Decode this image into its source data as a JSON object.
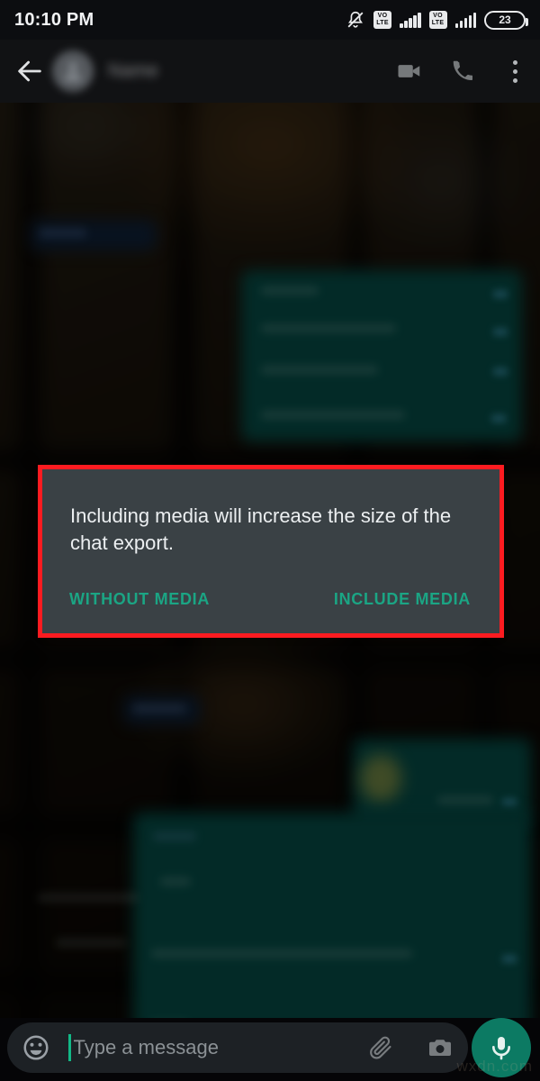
{
  "status_bar": {
    "clock": "10:10 PM",
    "icons": [
      {
        "name": "bell-muted-icon",
        "label": "silent"
      },
      {
        "name": "volte-badge-sim1",
        "label": "VoLTE"
      },
      {
        "name": "signal-bars-sim1",
        "label": "signal"
      },
      {
        "name": "volte-badge-sim2",
        "label": "VoLTE"
      },
      {
        "name": "signal-bars-sim2",
        "label": "signal"
      }
    ],
    "volte_top": "VO",
    "volte_bottom": "LTE",
    "battery_level": "23"
  },
  "app_bar": {
    "back_label": "Back",
    "contact_name": "Name",
    "video_call_label": "Video call",
    "voice_call_label": "Voice call",
    "menu_label": "More options"
  },
  "dialog": {
    "message": "Including media will increase the size of the chat export.",
    "without_media_label": "WITHOUT MEDIA",
    "include_media_label": "INCLUDE MEDIA",
    "background_color": "#3a4145",
    "accent_color": "#1ba584",
    "highlight_color": "#fc1b20"
  },
  "input_bar": {
    "placeholder": "Type a message",
    "emoji_label": "Emoji",
    "attach_label": "Attach",
    "camera_label": "Camera",
    "mic_label": "Voice message",
    "mic_button_color": "#0c7a63",
    "caret_color": "#12b886"
  },
  "watermark": {
    "text": "wxdn.com"
  }
}
